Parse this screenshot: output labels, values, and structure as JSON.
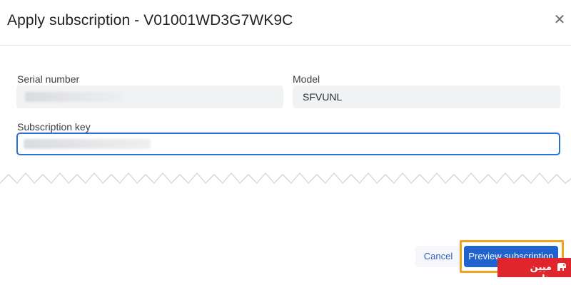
{
  "dialog": {
    "title": "Apply subscription - V01001WD3G7WK9C",
    "close_icon": "close-icon"
  },
  "fields": {
    "serial_label": "Serial number",
    "model_label": "Model",
    "model_value": "SFVUNL",
    "subscription_key_label": "Subscription key"
  },
  "actions": {
    "cancel_label": "Cancel",
    "preview_label": "Preview subscription"
  },
  "highlight_color": "#f0a21a",
  "accent_color": "#1f62d0",
  "watermark": {
    "text": "مبین هاست",
    "color": "#e0252c"
  }
}
